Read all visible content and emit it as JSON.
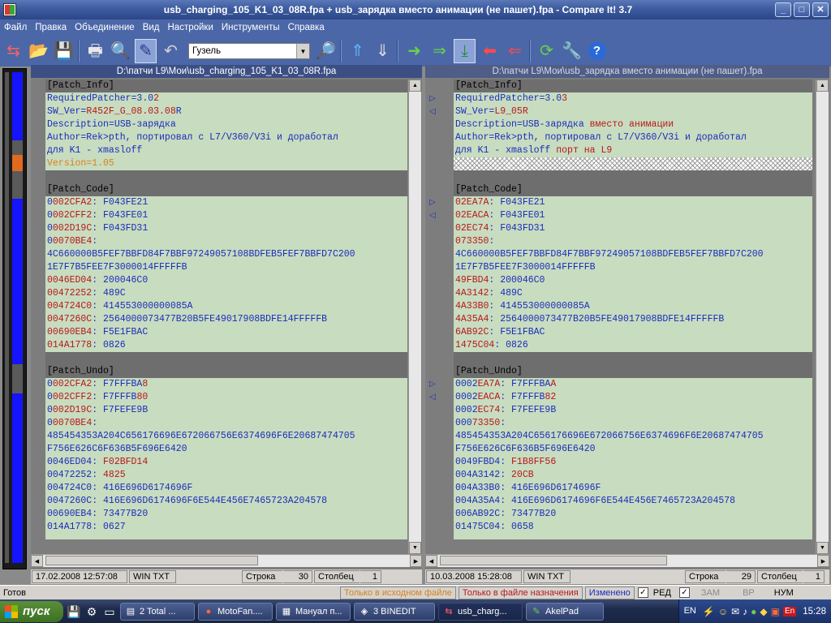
{
  "window": {
    "title": "usb_charging_105_K1_03_08R.fpa + usb_зарядка вместо анимации (не пашет).fpa - Compare It! 3.7"
  },
  "menu": [
    "Файл",
    "Правка",
    "Объединение",
    "Вид",
    "Настройки",
    "Инструменты",
    "Справка"
  ],
  "toolbar": {
    "combo_value": "Гузель"
  },
  "left": {
    "path": "D:\\патчи L9\\Мои\\usb_charging_105_K1_03_08R.fpa",
    "status": {
      "date": "17.02.2008  12:57:08",
      "enc": "WIN TXT",
      "row_label": "Строка",
      "row": "30",
      "col_label": "Столбец",
      "col": "1"
    }
  },
  "right": {
    "path": "D:\\патчи L9\\Мои\\usb_зарядка вместо анимации (не пашет).fpa",
    "status": {
      "date": "10.03.2008  15:28:08",
      "enc": "WIN TXT",
      "row_label": "Строка",
      "row": "29",
      "col_label": "Столбец",
      "col": "1"
    }
  },
  "statusbar": {
    "ready": "Готов",
    "tag_source": "Только в исходном файле",
    "tag_dest": "Только в файле назначения",
    "tag_changed": "Изменено",
    "red": "РЕД",
    "zam": "ЗАМ",
    "vr": "ВР",
    "num": "НУМ"
  },
  "taskbar": {
    "start": "пуск",
    "tasks": [
      "2 Total ...",
      "MotoFan....",
      "Мануал п...",
      "3 BINEDIT",
      "usb_charg...",
      "AkelPad"
    ],
    "lang": "EN",
    "tray_lang": "En",
    "clock": "15:28"
  },
  "colors": {
    "diff_line": "#b8181a",
    "removed_line": "#d9801a",
    "code_text": "#1a2dbb"
  }
}
